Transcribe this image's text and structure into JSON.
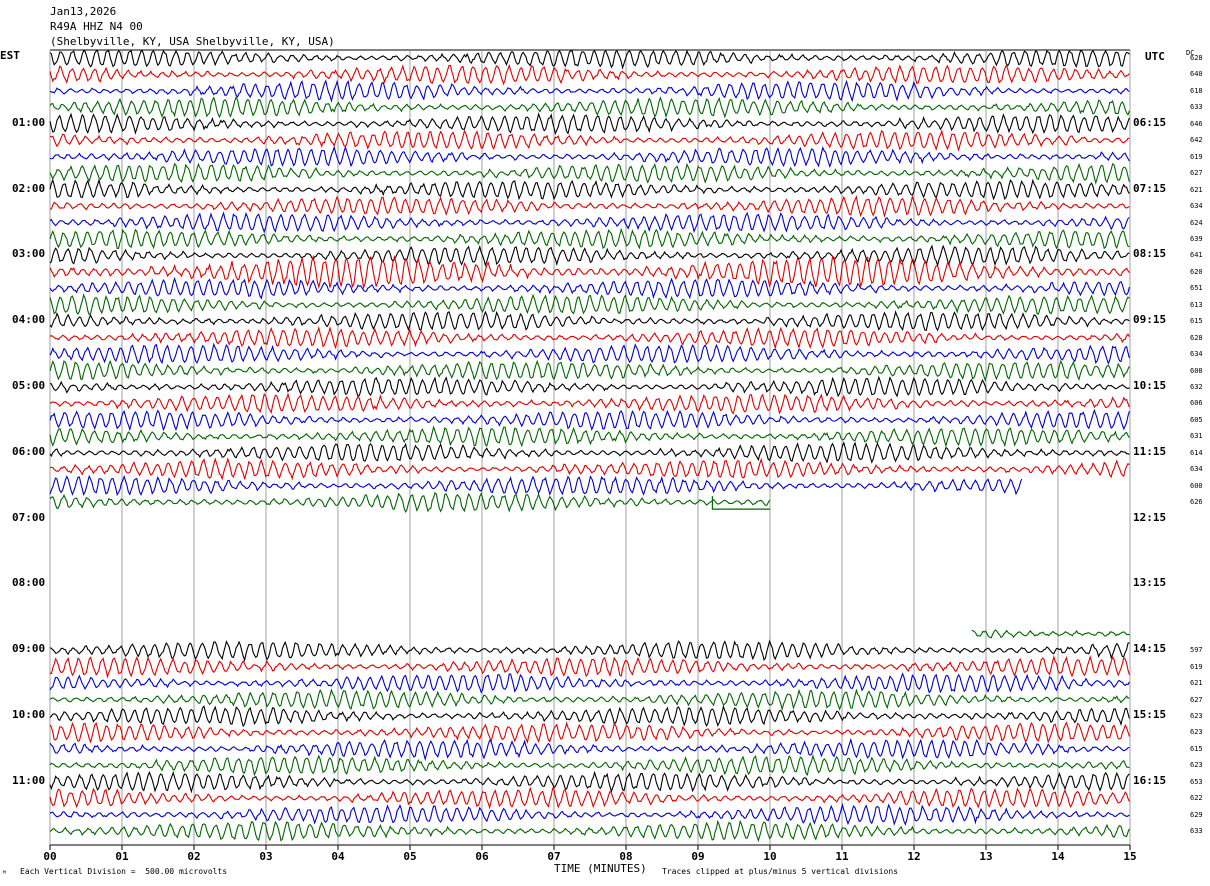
{
  "header": {
    "date": "Jan13,2026",
    "station": "R49A HHZ N4 00",
    "location": "(Shelbyville, KY, USA Shelbyville, KY, USA)"
  },
  "left_axis_label": "EST",
  "right_axis_label": "UTC",
  "dc_label": "DC",
  "footer": {
    "scale_note": "Each Vertical Division =  500.00 microvolts",
    "xlabel": "TIME (MINUTES)",
    "clip_note": "Traces clipped at plus/minus 5 vertical divisions",
    "corner_mark": "ᴹ"
  },
  "colors": {
    "black": "#000000",
    "red": "#dd0000",
    "blue": "#0000cc",
    "green": "#006600"
  },
  "chart_data": {
    "type": "line",
    "xlabel": "TIME (MINUTES)",
    "xlim": [
      0,
      15
    ],
    "x_ticks": [
      "00",
      "01",
      "02",
      "03",
      "04",
      "05",
      "06",
      "07",
      "08",
      "09",
      "10",
      "11",
      "12",
      "13",
      "14",
      "15"
    ],
    "row_minutes": 15,
    "rows_per_hour": 4,
    "color_cycle": [
      "black",
      "red",
      "blue",
      "green"
    ],
    "hour_labels": [
      {
        "est": "01:00",
        "utc": "06:15",
        "row": 4
      },
      {
        "est": "02:00",
        "utc": "07:15",
        "row": 8
      },
      {
        "est": "03:00",
        "utc": "08:15",
        "row": 12
      },
      {
        "est": "04:00",
        "utc": "09:15",
        "row": 16
      },
      {
        "est": "05:00",
        "utc": "10:15",
        "row": 20
      },
      {
        "est": "06:00",
        "utc": "11:15",
        "row": 24
      },
      {
        "est": "07:00",
        "utc": "12:15",
        "row": 28
      },
      {
        "est": "08:00",
        "utc": "13:15",
        "row": 32
      },
      {
        "est": "09:00",
        "utc": "14:15",
        "row": 36
      },
      {
        "est": "10:00",
        "utc": "15:15",
        "row": 40
      },
      {
        "est": "11:00",
        "utc": "16:15",
        "row": 44
      }
    ],
    "traces": [
      {
        "row": 0,
        "dc": "628",
        "start": 0,
        "end": 15
      },
      {
        "row": 1,
        "dc": "640",
        "start": 0,
        "end": 15
      },
      {
        "row": 2,
        "dc": "618",
        "start": 0,
        "end": 15
      },
      {
        "row": 3,
        "dc": "633",
        "start": 0,
        "end": 15
      },
      {
        "row": 4,
        "dc": "646",
        "start": 0,
        "end": 15
      },
      {
        "row": 5,
        "dc": "642",
        "start": 0,
        "end": 15
      },
      {
        "row": 6,
        "dc": "619",
        "start": 0,
        "end": 15
      },
      {
        "row": 7,
        "dc": "627",
        "start": 0,
        "end": 15
      },
      {
        "row": 8,
        "dc": "621",
        "start": 0,
        "end": 15
      },
      {
        "row": 9,
        "dc": "634",
        "start": 0,
        "end": 15
      },
      {
        "row": 10,
        "dc": "624",
        "start": 0,
        "end": 15
      },
      {
        "row": 11,
        "dc": "639",
        "start": 0,
        "end": 15
      },
      {
        "row": 12,
        "dc": "641",
        "start": 0,
        "end": 15
      },
      {
        "row": 13,
        "dc": "620",
        "start": 0,
        "end": 15
      },
      {
        "row": 14,
        "dc": "651",
        "start": 0,
        "end": 15
      },
      {
        "row": 15,
        "dc": "613",
        "start": 0,
        "end": 15
      },
      {
        "row": 16,
        "dc": "615",
        "start": 0,
        "end": 15
      },
      {
        "row": 17,
        "dc": "628",
        "start": 0,
        "end": 15
      },
      {
        "row": 18,
        "dc": "634",
        "start": 0,
        "end": 15
      },
      {
        "row": 19,
        "dc": "608",
        "start": 0,
        "end": 15
      },
      {
        "row": 20,
        "dc": "632",
        "start": 0,
        "end": 15
      },
      {
        "row": 21,
        "dc": "606",
        "start": 0,
        "end": 15
      },
      {
        "row": 22,
        "dc": "605",
        "start": 0,
        "end": 15
      },
      {
        "row": 23,
        "dc": "631",
        "start": 0,
        "end": 15
      },
      {
        "row": 24,
        "dc": "614",
        "start": 0,
        "end": 15
      },
      {
        "row": 25,
        "dc": "634",
        "start": 0,
        "end": 15
      },
      {
        "row": 26,
        "dc": "600",
        "start": 0,
        "end": 13.5
      },
      {
        "row": 27,
        "dc": "626",
        "start": 0,
        "end": 10
      },
      {
        "row": 36,
        "dc": "597",
        "start": 0,
        "end": 15
      },
      {
        "row": 37,
        "dc": "619",
        "start": 0,
        "end": 15
      },
      {
        "row": 38,
        "dc": "621",
        "start": 0,
        "end": 15
      },
      {
        "row": 39,
        "dc": "627",
        "start": 0,
        "end": 15
      },
      {
        "row": 40,
        "dc": "623",
        "start": 0,
        "end": 15
      },
      {
        "row": 41,
        "dc": "623",
        "start": 0,
        "end": 15
      },
      {
        "row": 42,
        "dc": "615",
        "start": 0,
        "end": 15
      },
      {
        "row": 43,
        "dc": "623",
        "start": 0,
        "end": 15
      },
      {
        "row": 44,
        "dc": "653",
        "start": 0,
        "end": 15
      },
      {
        "row": 45,
        "dc": "622",
        "start": 0,
        "end": 15
      },
      {
        "row": 46,
        "dc": "629",
        "start": 0,
        "end": 15
      },
      {
        "row": 47,
        "dc": "633",
        "start": 0,
        "end": 15
      }
    ],
    "late_segment": {
      "row": 35,
      "start": 12.8,
      "end": 15
    },
    "flat_segment": {
      "row": 27,
      "start": 9.2,
      "end": 10
    }
  }
}
